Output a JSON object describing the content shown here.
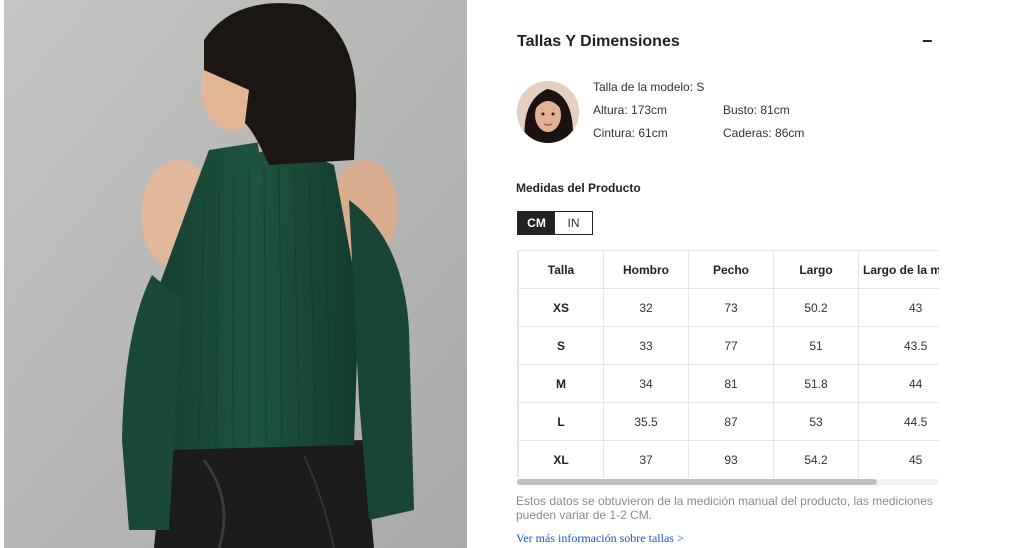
{
  "section": {
    "title": "Tallas Y Dimensiones",
    "collapse_symbol": "−"
  },
  "model": {
    "size": "Talla de la modelo: S",
    "height": "Altura: 173cm",
    "bust": "Busto: 81cm",
    "waist": "Cintura: 61cm",
    "hips": "Caderas: 86cm"
  },
  "measurements": {
    "label": "Medidas del Producto",
    "units": [
      "CM",
      "IN"
    ],
    "active_unit": "CM",
    "columns": [
      "Talla",
      "Hombro",
      "Pecho",
      "Largo",
      "Largo de la m"
    ],
    "rows": [
      [
        "XS",
        "32",
        "73",
        "50.2",
        "43"
      ],
      [
        "S",
        "33",
        "77",
        "51",
        "43.5"
      ],
      [
        "M",
        "34",
        "81",
        "51.8",
        "44"
      ],
      [
        "L",
        "35.5",
        "87",
        "53",
        "44.5"
      ],
      [
        "XL",
        "37",
        "93",
        "54.2",
        "45"
      ]
    ]
  },
  "note": "Estos datos se obtuvieron de la medición manual del producto, las mediciones pueden variar de 1-2 CM.",
  "link": "Ver más información sobre tallas >",
  "colors": {
    "sweater_green": "#1d4e3a",
    "link_blue": "#1a55c8",
    "toggle_active": "#222222"
  }
}
